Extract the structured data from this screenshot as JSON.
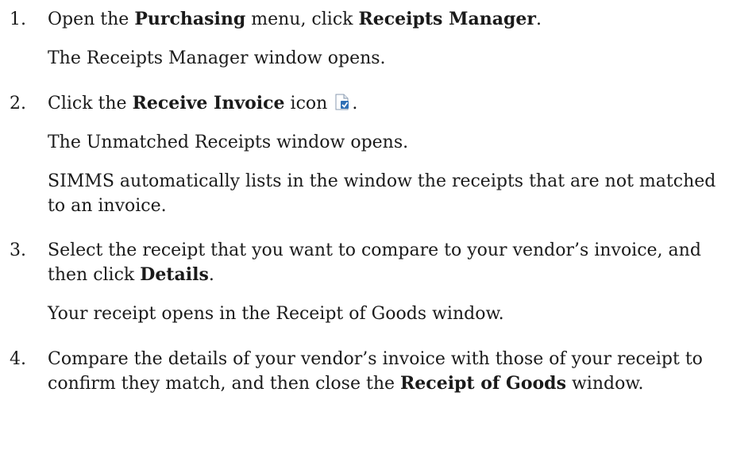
{
  "steps": [
    {
      "number": "1.",
      "instruction": {
        "t1": "Open the ",
        "menu": "Purchasing",
        "t2": " menu, click ",
        "item": "Receipts Manager",
        "t3": "."
      },
      "result": "The Receipts Manager window opens."
    },
    {
      "number": "2.",
      "instruction": {
        "t1": "Click the ",
        "button": "Receive Invoice",
        "t2": " icon ",
        "t3": "."
      },
      "icon": "receive-invoice-icon",
      "result": "The Unmatched Receipts window opens.",
      "note": "SIMMS automatically lists in the window the receipts that are not matched to an invoice."
    },
    {
      "number": "3.",
      "instruction": {
        "t1": "Select the receipt that you want to compare to your vendor’s invoice, and then click ",
        "button": "Details",
        "t2": "."
      },
      "result": "Your receipt opens in the Receipt of Goods window."
    },
    {
      "number": "4.",
      "instruction": {
        "t1": "Compare the details of your vendor’s invoice with those of your receipt to confirm they match, and then close the ",
        "window": "Receipt of Goods",
        "t2": " window."
      }
    }
  ]
}
